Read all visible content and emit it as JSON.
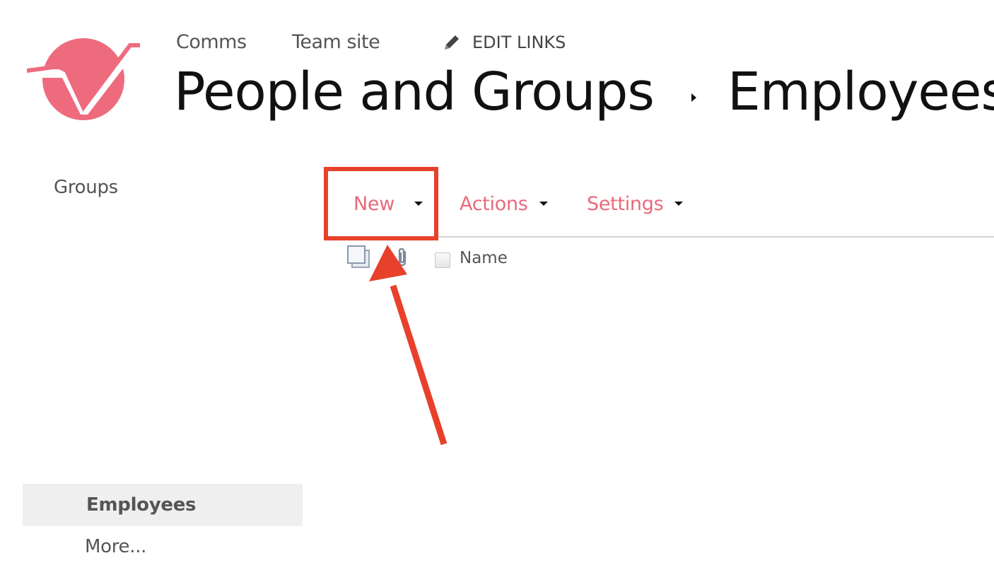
{
  "top_nav": {
    "links": [
      "Comms",
      "Team site"
    ],
    "edit_links_label": "EDIT LINKS",
    "edit_icon": "pencil-icon"
  },
  "title": {
    "section": "People and Groups",
    "page": "Employees",
    "separator_icon": "caret-right-icon"
  },
  "left_nav": {
    "heading": "Groups",
    "selected": "Employees",
    "more": "More..."
  },
  "toolbar": {
    "new_label": "New",
    "actions_label": "Actions",
    "settings_label": "Settings",
    "accent_color": "#e86a7c"
  },
  "list_header": {
    "name_column": "Name",
    "icons": [
      "copy-icon",
      "paperclip-icon"
    ]
  },
  "annotation": {
    "highlight_color": "#e8412b"
  },
  "colors": {
    "logo": "#ee6b7e",
    "text_dark": "#111111",
    "text_muted": "#555555"
  }
}
